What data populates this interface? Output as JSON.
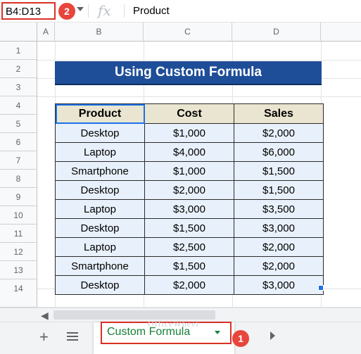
{
  "formula_bar": {
    "name_box": "B4:D13",
    "fx_symbol": "fx",
    "content": "Product"
  },
  "annotations": {
    "step1": "1",
    "step2": "2"
  },
  "columns": [
    "A",
    "B",
    "C",
    "D"
  ],
  "rows": [
    "1",
    "2",
    "3",
    "4",
    "5",
    "6",
    "7",
    "8",
    "9",
    "10",
    "11",
    "12",
    "13",
    "14"
  ],
  "title": "Using Custom Formula",
  "table": {
    "headers": [
      "Product",
      "Cost",
      "Sales"
    ],
    "rows": [
      [
        "Desktop",
        "$1,000",
        "$2,000"
      ],
      [
        "Laptop",
        "$4,000",
        "$6,000"
      ],
      [
        "Smartphone",
        "$1,000",
        "$1,500"
      ],
      [
        "Desktop",
        "$2,000",
        "$1,500"
      ],
      [
        "Laptop",
        "$3,000",
        "$3,500"
      ],
      [
        "Desktop",
        "$1,500",
        "$3,000"
      ],
      [
        "Laptop",
        "$2,500",
        "$2,000"
      ],
      [
        "Smartphone",
        "$1,500",
        "$2,000"
      ],
      [
        "Desktop",
        "$2,000",
        "$3,000"
      ]
    ]
  },
  "sheet_tabs": {
    "add": "+",
    "active": "Custom Formula"
  },
  "watermark": "OfficeWheel",
  "colors": {
    "title_bg": "#1f4e98",
    "header_bg": "#e9e5d0",
    "cell_bg": "#e8f1fb",
    "highlight": "#d93025",
    "tab_text": "#188038"
  }
}
